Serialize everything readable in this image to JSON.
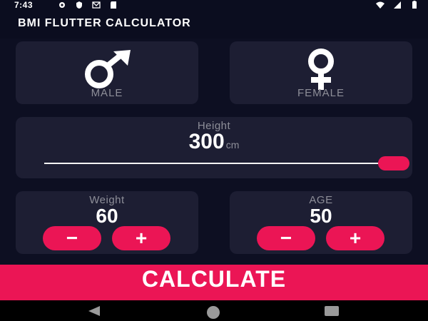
{
  "status_bar": {
    "time": "7:43",
    "left_icons": [
      "settings-icon",
      "shield-icon",
      "mail-icon",
      "sd-card-icon"
    ],
    "right_icons": [
      "wifi-icon",
      "signal-icon",
      "battery-icon"
    ]
  },
  "app_bar": {
    "title": "BMI FLUTTER CALCULATOR"
  },
  "gender": {
    "male": {
      "label": "MALE",
      "icon": "male-icon"
    },
    "female": {
      "label": "FEMALE",
      "icon": "female-icon"
    }
  },
  "height": {
    "label": "Height",
    "value": "300",
    "unit": "cm",
    "slider_fraction": 1.0
  },
  "weight": {
    "label": "Weight",
    "value": "60",
    "minus_label": "−",
    "plus_label": "+"
  },
  "age": {
    "label": "AGE",
    "value": "50",
    "minus_label": "−",
    "plus_label": "+"
  },
  "calculate": {
    "label": "CALCULATE"
  },
  "colors": {
    "background": "#0d0f22",
    "card": "#1d1e33",
    "accent": "#eb1555",
    "label": "#8d8e98"
  },
  "nav_bar": {
    "icons": [
      "back-icon",
      "home-icon",
      "recents-icon"
    ]
  }
}
